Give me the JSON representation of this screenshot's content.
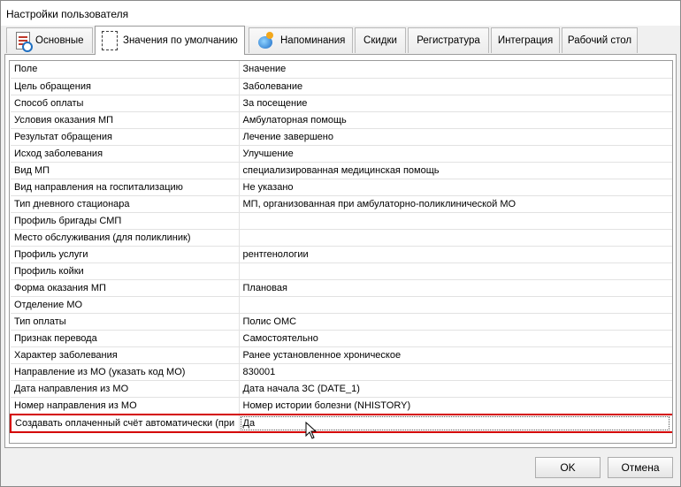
{
  "window": {
    "title": "Настройки пользователя"
  },
  "tabs": [
    {
      "label": "Основные",
      "icon": "document-report-icon"
    },
    {
      "label": "Значения по умолчанию",
      "icon": "blank-page-icon"
    },
    {
      "label": "Напоминания",
      "icon": "reminder-globe-icon"
    },
    {
      "label": "Скидки"
    },
    {
      "label": "Регистратура"
    },
    {
      "label": "Интеграция"
    },
    {
      "label": "Рабочий стол"
    }
  ],
  "active_tab": "Значения по умолчанию",
  "grid": {
    "columns": [
      "Поле",
      "Значение"
    ],
    "rows": [
      {
        "field": "Цель обращения",
        "value": "Заболевание"
      },
      {
        "field": "Способ оплаты",
        "value": "За посещение"
      },
      {
        "field": "Условия оказания МП",
        "value": "Амбулаторная помощь"
      },
      {
        "field": "Результат обращения",
        "value": "Лечение завершено"
      },
      {
        "field": "Исход заболевания",
        "value": "Улучшение"
      },
      {
        "field": "Вид МП",
        "value": "специализированная медицинская помощь"
      },
      {
        "field": "Вид направления на госпитализацию",
        "value": "Не указано"
      },
      {
        "field": "Тип дневного стационара",
        "value": "МП, организованная при амбулаторно-поликлинической МО"
      },
      {
        "field": "Профиль бригады СМП",
        "value": ""
      },
      {
        "field": "Место обслуживания (для поликлиник)",
        "value": ""
      },
      {
        "field": "Профиль услуги",
        "value": "рентгенологии"
      },
      {
        "field": "Профиль койки",
        "value": ""
      },
      {
        "field": "Форма оказания МП",
        "value": "Плановая"
      },
      {
        "field": "Отделение МО",
        "value": ""
      },
      {
        "field": "Тип оплаты",
        "value": "Полис ОМС"
      },
      {
        "field": "Признак перевода",
        "value": "Самостоятельно"
      },
      {
        "field": "Характер заболевания",
        "value": "Ранее установленное хроническое"
      },
      {
        "field": "Направление из МО (указать код МО)",
        "value": "830001"
      },
      {
        "field": "Дата направления из МО",
        "value": "Дата начала ЗС (DATE_1)"
      },
      {
        "field": "Номер направления из МО",
        "value": "Номер истории болезни (NHISTORY)"
      },
      {
        "field": "Создавать оплаченный счёт автоматически (при",
        "value": "Да"
      }
    ],
    "selected_row": 20
  },
  "buttons": {
    "ok": "OK",
    "cancel": "Отмена"
  },
  "colors": {
    "selection_border": "#d40000"
  }
}
